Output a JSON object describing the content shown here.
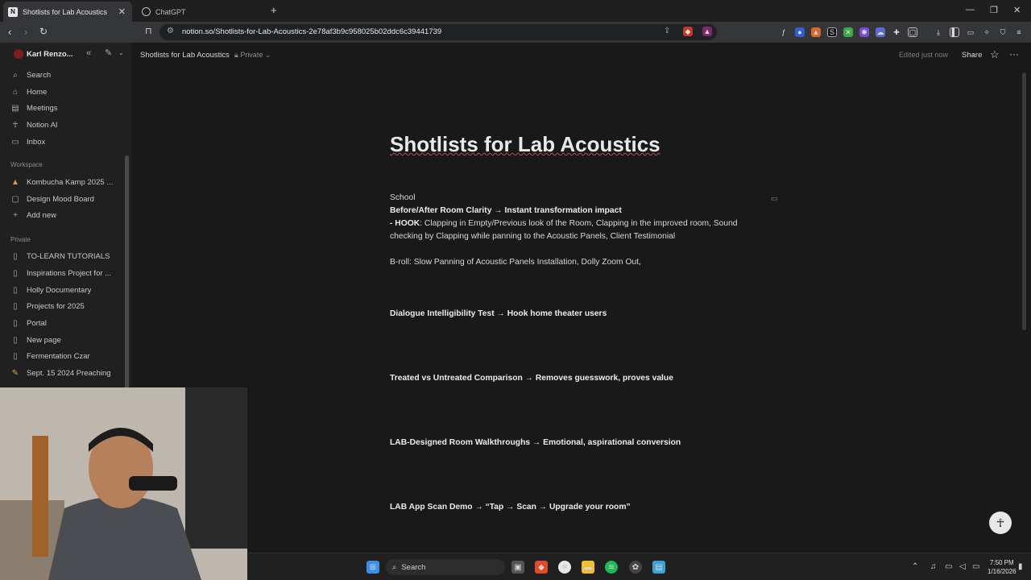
{
  "browser": {
    "tabs": [
      {
        "title": "Shotlists for Lab Acoustics",
        "active": true
      },
      {
        "title": "ChatGPT",
        "active": false
      }
    ],
    "url": "notion.so/Shotlists-for-Lab-Acoustics-2e78af3b9c958025b02ddc6c39441739"
  },
  "sidebar": {
    "user": "Karl Renzo...",
    "top_items": [
      {
        "label": "Search",
        "icon": "search-icon"
      },
      {
        "label": "Home",
        "icon": "home-icon"
      },
      {
        "label": "Meetings",
        "icon": "meetings-icon"
      },
      {
        "label": "Notion AI",
        "icon": "notion-ai-icon"
      },
      {
        "label": "Inbox",
        "icon": "inbox-icon"
      }
    ],
    "workspace_label": "Workspace",
    "workspace_items": [
      {
        "label": "Kombucha Kamp 2025 ...",
        "icon": "tent-icon"
      },
      {
        "label": "Design Mood Board",
        "icon": "board-icon"
      },
      {
        "label": "Add new",
        "icon": "plus-icon"
      }
    ],
    "private_label": "Private",
    "private_items": [
      {
        "label": "TO-LEARN TUTORIALS",
        "icon": "page-icon"
      },
      {
        "label": "Inspirations Project for ...",
        "icon": "page-icon"
      },
      {
        "label": "Holly Documentary",
        "icon": "page-icon"
      },
      {
        "label": "Projects for 2025",
        "icon": "page-icon"
      },
      {
        "label": "Portal",
        "icon": "page-icon"
      },
      {
        "label": "New page",
        "icon": "page-icon"
      },
      {
        "label": "Fermentation Czar",
        "icon": "page-icon"
      },
      {
        "label": "Sept. 15 2024 Preaching",
        "icon": "pencil-icon"
      }
    ]
  },
  "header": {
    "breadcrumb": "Shotlists for Lab Acoustics",
    "visibility": "Private",
    "edited": "Edited just now",
    "share": "Share"
  },
  "page": {
    "title": "Shotlists for Lab Acoustics",
    "blocks": {
      "school": "School",
      "h1": "Before/After Room Clarity → Instant transformation impact",
      "hook_label": "- HOOK",
      "hook_text": ": Clapping in Empty/Previous look of the Room, Clapping in the improved room, Sound checking by Clapping while panning to the Acoustic Panels, Client Testimonial",
      "broll": "B-roll: Slow Panning of Acoustic Panels Installation, Dolly Zoom Out,",
      "h2": "Dialogue Intelligibility Test → Hook home theater users",
      "h3": "Treated vs Untreated Comparison → Removes guesswork, proves value",
      "h4": "LAB-Designed Room Walkthroughs → Emotional, aspirational conversion",
      "h5": "LAB App Scan Demo → “Tap → Scan → Upgrade your room”"
    }
  },
  "taskbar": {
    "search": "Search",
    "time": "7:50 PM",
    "date": "1/16/2026"
  }
}
